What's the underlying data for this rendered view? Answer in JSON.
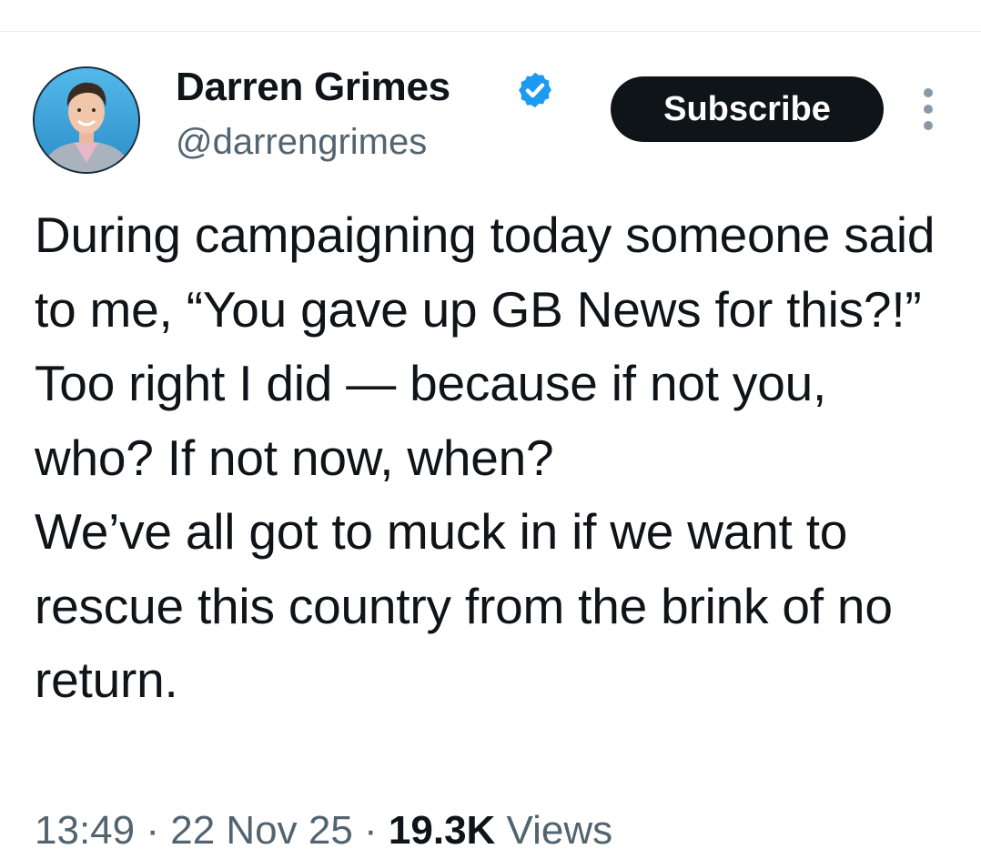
{
  "author": {
    "display_name": "Darren Grimes",
    "handle": "@darrengrimes",
    "verified": true,
    "avatar_icon": "profile-photo",
    "badge_color": "#1d9bf0"
  },
  "actions": {
    "subscribe_label": "Subscribe",
    "more_icon": "vertical-ellipsis-icon"
  },
  "tweet": {
    "text": "During campaigning today someone said to me, “You gave up GB News for this?!” Too right I did — because if not you, who? If not now, when?\nWe’ve all got to muck in if we want to rescue this country from the brink of no return."
  },
  "meta": {
    "time": "13:49",
    "separator": " · ",
    "date": "22 Nov 25",
    "views_count": "19.3K",
    "views_label": " Views"
  },
  "colors": {
    "text_primary": "#0f1419",
    "text_secondary": "#536471",
    "button_bg": "#0f1419",
    "divider": "#e6e9eb"
  }
}
